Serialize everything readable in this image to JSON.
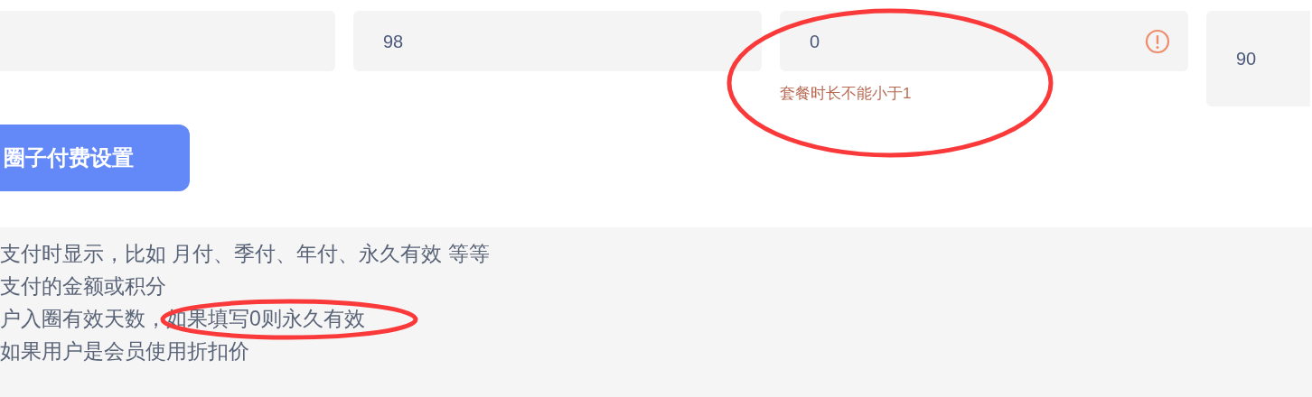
{
  "fields": [
    {
      "error": false
    },
    {
      "value": "98",
      "error": false
    },
    {
      "value": "0",
      "error": true,
      "error_message": "套餐时长不能小于1"
    },
    {
      "value": "90",
      "error": false
    }
  ],
  "button": {
    "label": "圈子付费设置"
  },
  "help_lines": [
    "支付时显示，比如 月付、季付、年付、永久有效 等等",
    "支付的金额或积分",
    "户入圈有效天数，如果填写0则永久有效",
    "如果用户是会员使用折扣价"
  ],
  "annotations": [
    {
      "kind": "ellipse",
      "color": "#fa3a3a"
    },
    {
      "kind": "ellipse",
      "color": "#fa3a3a"
    }
  ]
}
